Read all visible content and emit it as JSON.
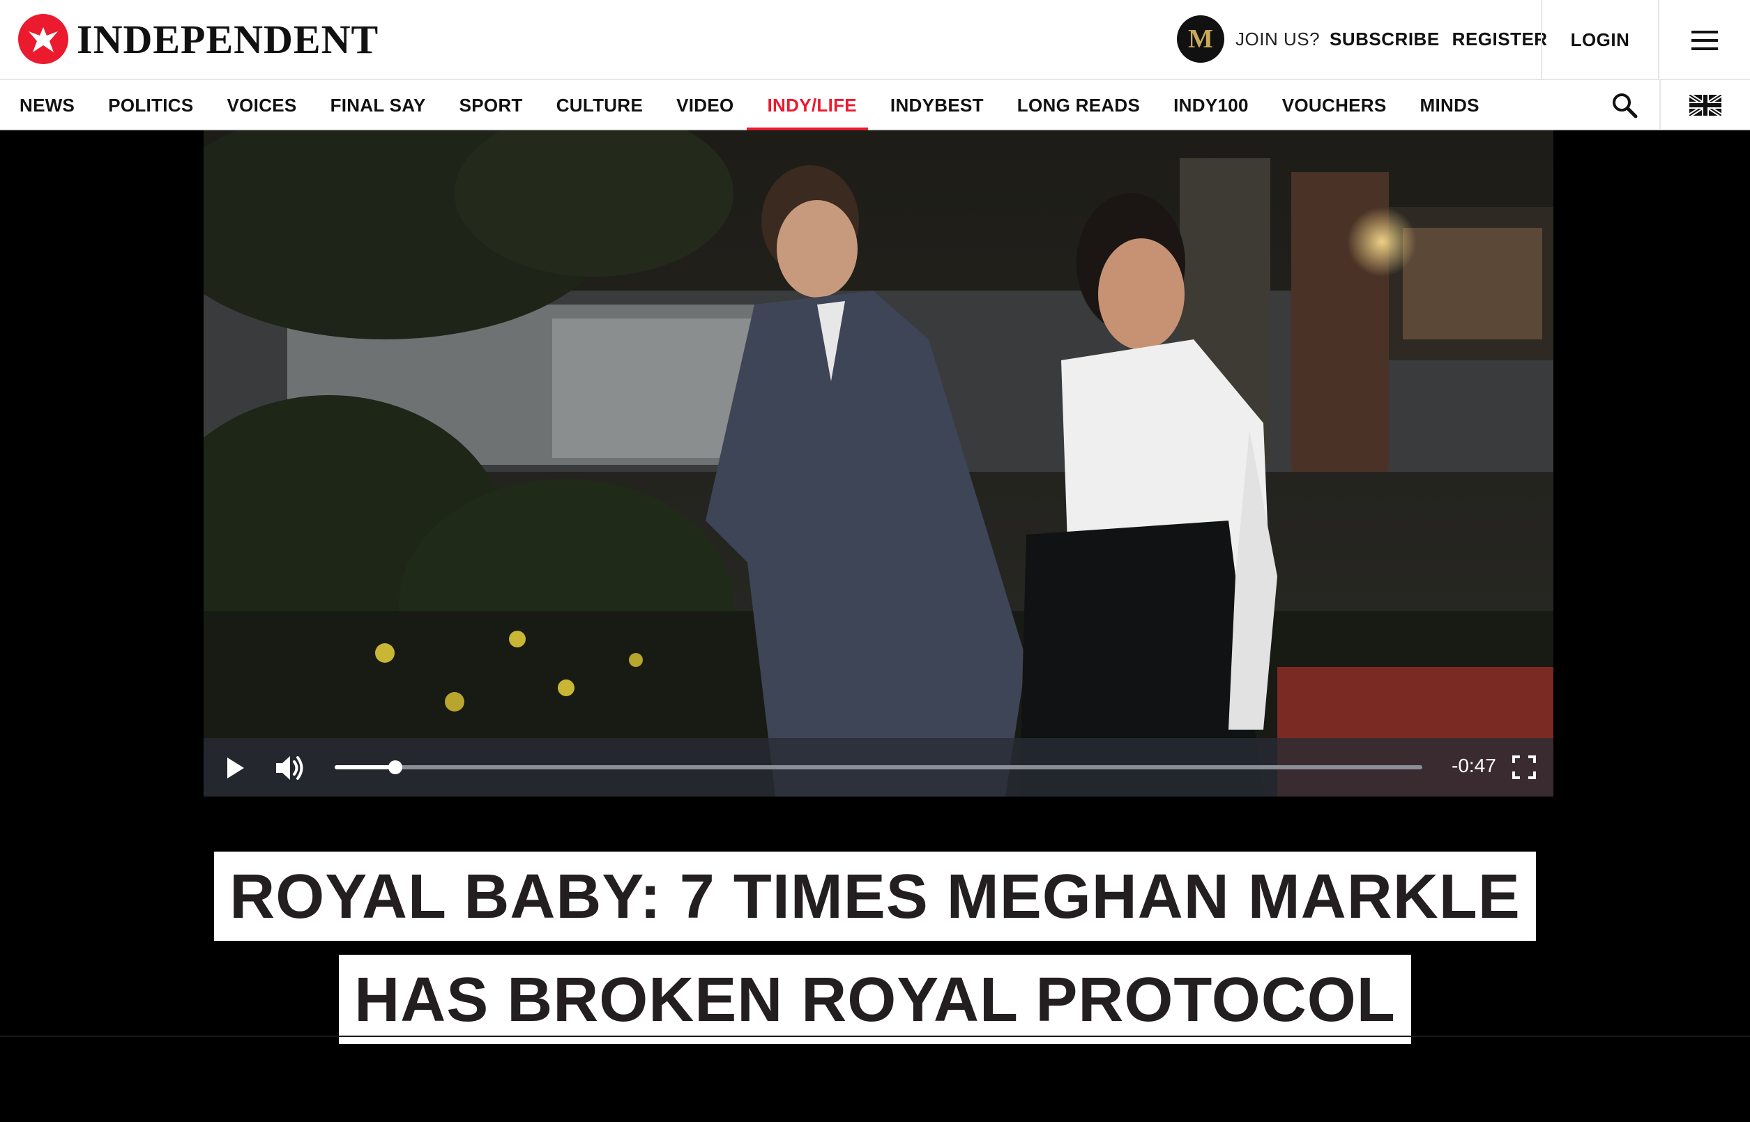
{
  "brand": {
    "name": "INDEPENDENT",
    "accent": "#ec1a2e"
  },
  "header": {
    "join_label": "JOIN US?",
    "subscribe_label": "SUBSCRIBE",
    "register_label": "REGISTER",
    "login_label": "LOGIN",
    "badge_letter": "M"
  },
  "nav": {
    "items": [
      "NEWS",
      "POLITICS",
      "VOICES",
      "FINAL SAY",
      "SPORT",
      "CULTURE",
      "VIDEO",
      "INDY/LIFE",
      "INDYBEST",
      "LONG READS",
      "INDY100",
      "VOUCHERS",
      "MINDS"
    ],
    "active": "INDY/LIFE",
    "active_parts": {
      "prefix": "INDY",
      "slash": "/",
      "suffix": "LIFE"
    }
  },
  "video": {
    "time_remaining": "-0:47",
    "progress_fraction": 0.056,
    "icons": [
      "play-icon",
      "volume-icon",
      "fullscreen-icon"
    ]
  },
  "headline": {
    "line1": "ROYAL BABY: 7 TIMES MEGHAN MARKLE",
    "line2": "HAS BROKEN ROYAL PROTOCOL"
  }
}
